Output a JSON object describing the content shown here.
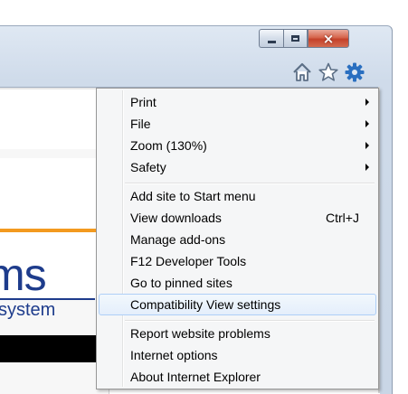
{
  "window": {
    "caption_buttons": {
      "minimize": "minimize",
      "maximize": "maximize",
      "close": "×"
    }
  },
  "toolbar": {
    "icons": [
      "home-icon",
      "favorites-star-icon",
      "tools-gear-icon"
    ],
    "accent": "#2a6fc0"
  },
  "page": {
    "logo_main": "ms",
    "logo_sub": "system",
    "logo_color": "#1e3c8c",
    "accent_line": "#f39a1f"
  },
  "menu": {
    "groups": [
      [
        {
          "label": "Print",
          "submenu": true
        },
        {
          "label": "File",
          "submenu": true
        },
        {
          "label": "Zoom (130%)",
          "submenu": true
        },
        {
          "label": "Safety",
          "submenu": true
        }
      ],
      [
        {
          "label": "Add site to Start menu"
        },
        {
          "label": "View downloads",
          "shortcut": "Ctrl+J"
        },
        {
          "label": "Manage add-ons"
        },
        {
          "label": "F12 Developer Tools"
        },
        {
          "label": "Go to pinned sites"
        },
        {
          "label": "Compatibility View settings",
          "highlighted": true
        }
      ],
      [
        {
          "label": "Report website problems"
        },
        {
          "label": "Internet options"
        },
        {
          "label": "About Internet Explorer"
        }
      ]
    ]
  }
}
